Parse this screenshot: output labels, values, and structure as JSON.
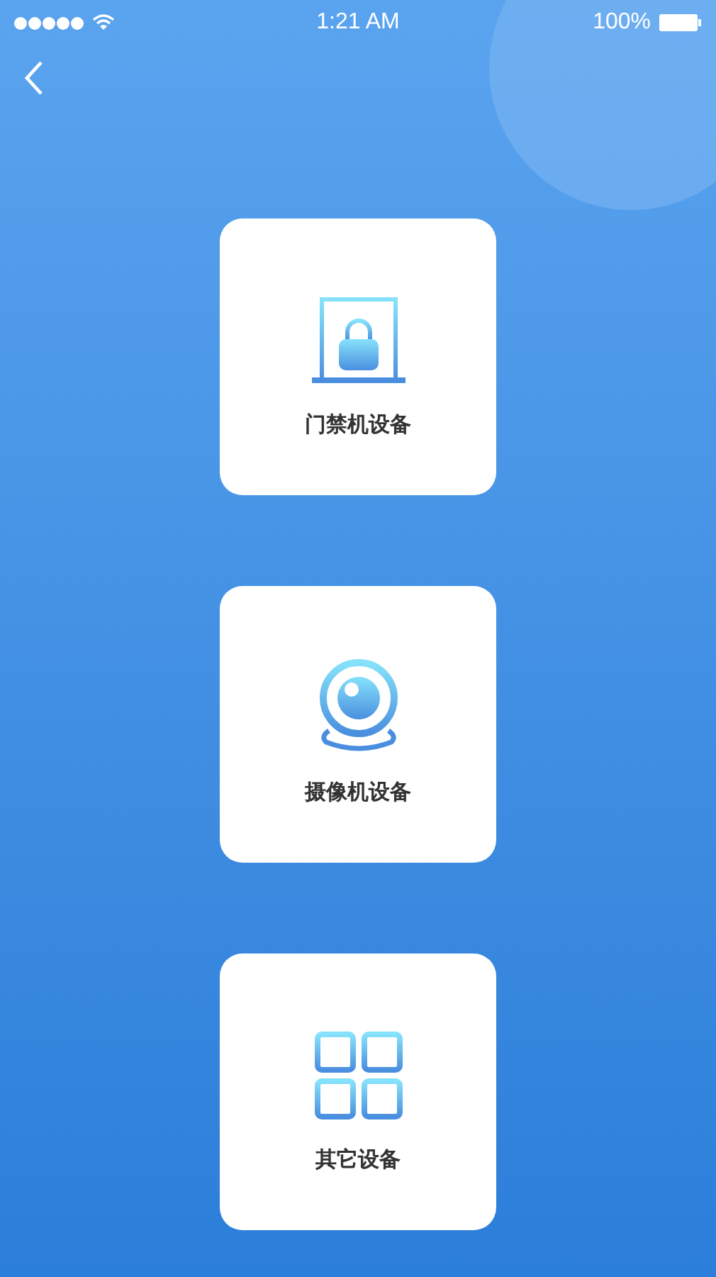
{
  "status_bar": {
    "time": "1:21 AM",
    "battery": "100%"
  },
  "devices": [
    {
      "kind": "door",
      "label": "门禁机设备"
    },
    {
      "kind": "camera",
      "label": "摄像机设备"
    },
    {
      "kind": "other",
      "label": "其它设备"
    }
  ]
}
